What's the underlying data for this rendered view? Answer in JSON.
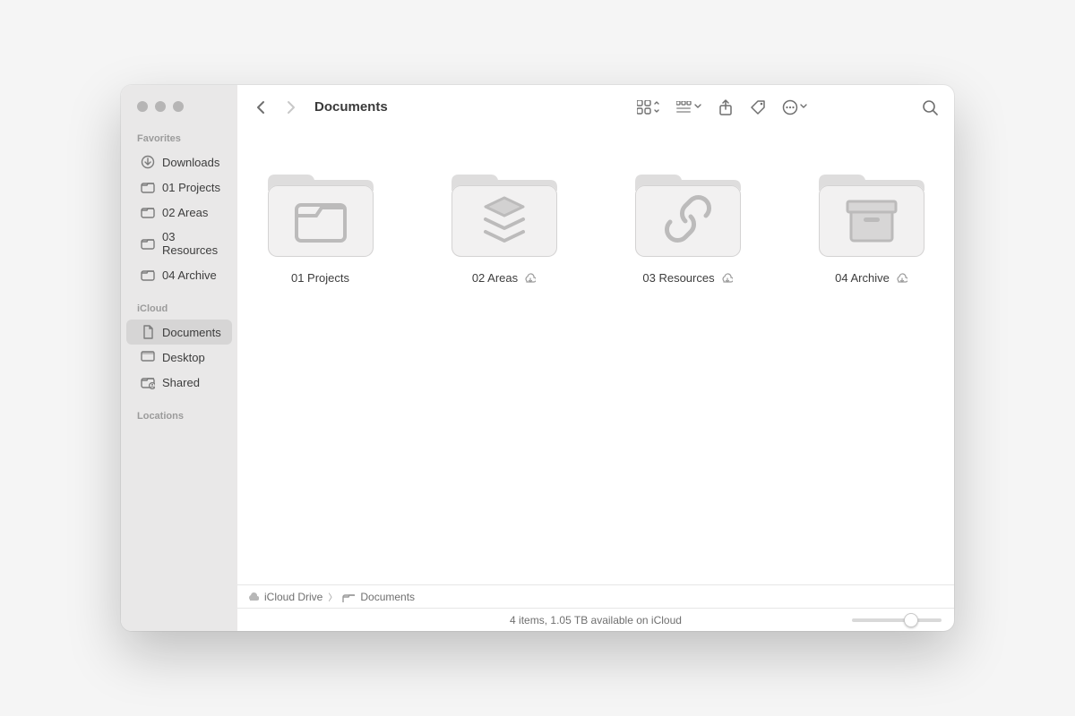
{
  "toolbar": {
    "title": "Documents"
  },
  "sidebar": {
    "sections": [
      {
        "label": "Favorites",
        "items": [
          {
            "name": "Downloads",
            "icon": "download"
          },
          {
            "name": "01 Projects",
            "icon": "folder"
          },
          {
            "name": "02 Areas",
            "icon": "folder"
          },
          {
            "name": "03 Resources",
            "icon": "folder"
          },
          {
            "name": "04 Archive",
            "icon": "folder"
          }
        ]
      },
      {
        "label": "iCloud",
        "items": [
          {
            "name": "Documents",
            "icon": "document",
            "selected": true
          },
          {
            "name": "Desktop",
            "icon": "desktop"
          },
          {
            "name": "Shared",
            "icon": "shared"
          }
        ]
      },
      {
        "label": "Locations",
        "items": []
      }
    ]
  },
  "folders": [
    {
      "name": "01 Projects",
      "glyph": "project",
      "cloud": false
    },
    {
      "name": "02 Areas",
      "glyph": "areas",
      "cloud": true
    },
    {
      "name": "03 Resources",
      "glyph": "resource",
      "cloud": true
    },
    {
      "name": "04 Archive",
      "glyph": "archive",
      "cloud": true
    }
  ],
  "pathbar": {
    "root": "iCloud Drive",
    "leaf": "Documents"
  },
  "statusbar": {
    "text": "4 items, 1.05 TB available on iCloud"
  }
}
